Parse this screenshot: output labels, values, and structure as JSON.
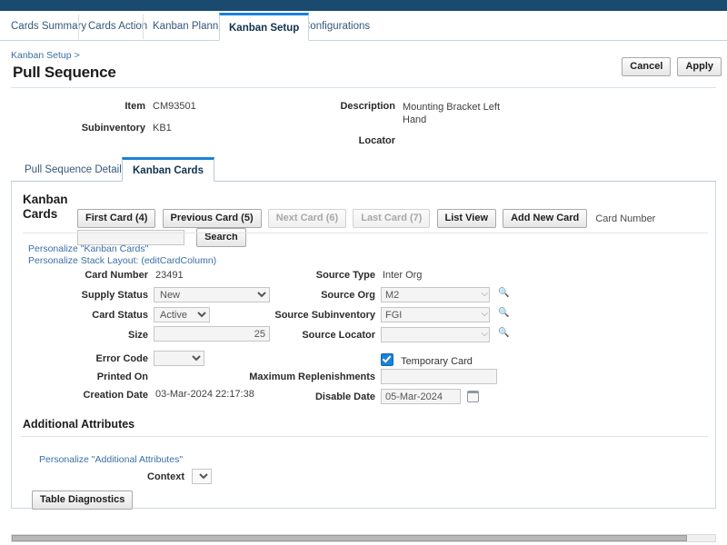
{
  "theme": {
    "topbar_color": "#1a4a6e",
    "accent_color": "#1a82d8",
    "link_color": "#3b6ea5"
  },
  "global_tabs": [
    {
      "label": "Cards Summary",
      "active": false
    },
    {
      "label": "Cards Action",
      "active": false
    },
    {
      "label": "Kanban Planning",
      "active": false
    },
    {
      "label": "Kanban Setup",
      "active": true
    },
    {
      "label": "Configurations",
      "active": false
    }
  ],
  "breadcrumb": {
    "parent": "Kanban Setup",
    "separator": ">"
  },
  "page_title": "Pull Sequence",
  "header_actions": {
    "cancel": "Cancel",
    "apply": "Apply"
  },
  "item_header": {
    "item_label": "Item",
    "item_value": "CM93501",
    "subinventory_label": "Subinventory",
    "subinventory_value": "KB1",
    "description_label": "Description",
    "description_value": "Mounting Bracket Left Hand",
    "locator_label": "Locator",
    "locator_value": ""
  },
  "sub_tabs": [
    {
      "label": "Pull Sequence Details",
      "active": false
    },
    {
      "label": "Kanban Cards",
      "active": true
    }
  ],
  "kanban_cards": {
    "section_title": "Kanban Cards",
    "buttons": [
      {
        "label": "First Card (4)",
        "disabled": false
      },
      {
        "label": "Previous Card (5)",
        "disabled": false
      },
      {
        "label": "Next Card (6)",
        "disabled": true
      },
      {
        "label": "Last Card (7)",
        "disabled": true
      },
      {
        "label": "List View",
        "disabled": false
      },
      {
        "label": "Add New Card",
        "disabled": false
      }
    ],
    "card_number_label": "Card Number",
    "card_number_search_value": "",
    "search_button": "Search",
    "personalize_cards": "Personalize \"Kanban Cards\"",
    "personalize_stack": "Personalize Stack Layout: (editCardColumn)",
    "fields": {
      "card_number_label": "Card Number",
      "card_number_value": "23491",
      "supply_status_label": "Supply Status",
      "supply_status_value": "New",
      "card_status_label": "Card Status",
      "card_status_value": "Active",
      "size_label": "Size",
      "size_value": "25",
      "error_code_label": "Error Code",
      "error_code_value": "",
      "printed_on_label": "Printed On",
      "printed_on_value": "",
      "creation_date_label": "Creation Date",
      "creation_date_value": "03-Mar-2024 22:17:38",
      "source_type_label": "Source Type",
      "source_type_value": "Inter Org",
      "source_org_label": "Source Org",
      "source_org_value": "M2",
      "source_subinventory_label": "Source Subinventory",
      "source_subinventory_value": "FGI",
      "source_locator_label": "Source Locator",
      "source_locator_value": "",
      "temporary_card_label": "Temporary Card",
      "temporary_card_checked": true,
      "max_replenishments_label": "Maximum Replenishments",
      "max_replenishments_value": "",
      "disable_date_label": "Disable Date",
      "disable_date_value": "05-Mar-2024"
    }
  },
  "additional_attributes": {
    "section_title": "Additional Attributes",
    "personalize_link": "Personalize \"Additional Attributes\"",
    "context_label": "Context",
    "context_value": "",
    "table_diagnostics_button": "Table Diagnostics"
  },
  "icons": {
    "lov_arrow": "lov-dropdown-icon",
    "lov_search": "lov-search-icon",
    "calendar": "calendar-icon",
    "chevron_down": "chevron-down-icon"
  }
}
